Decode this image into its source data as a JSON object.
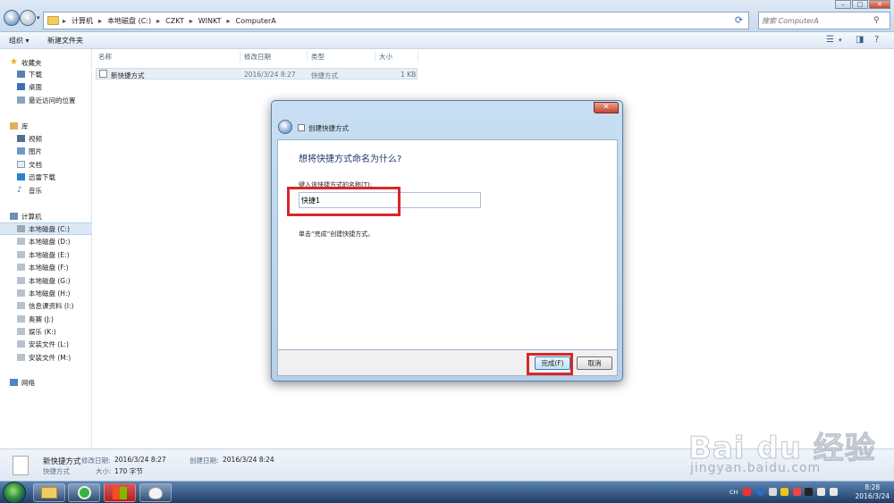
{
  "address_bar": {
    "breadcrumbs": [
      "计算机",
      "本地磁盘 (C:)",
      "CZKT",
      "WINKT",
      "ComputerA"
    ],
    "search_placeholder": "搜索 ComputerA"
  },
  "toolbar": {
    "organize_label": "组织 ▾",
    "new_folder_label": "新建文件夹"
  },
  "nav": {
    "favorites_header": "收藏夹",
    "favorites": [
      "下载",
      "桌面",
      "最近访问的位置"
    ],
    "libraries_header": "库",
    "libraries": [
      "视频",
      "图片",
      "文档",
      "迅雷下载",
      "音乐"
    ],
    "computer_header": "计算机",
    "drives": [
      "本地磁盘 (C:)",
      "本地磁盘 (D:)",
      "本地磁盘 (E:)",
      "本地磁盘 (F:)",
      "本地磁盘 (G:)",
      "本地磁盘 (H:)",
      "信息课资料 (I:)",
      "奥赛 (J:)",
      "娱乐 (K:)",
      "安装文件 (L:)",
      "安装文件 (M:)"
    ],
    "network_label": "网络"
  },
  "file_list": {
    "columns": [
      "名称",
      "修改日期",
      "类型",
      "大小"
    ],
    "rows": [
      {
        "name": "新快捷方式",
        "modified": "2016/3/24 8:27",
        "type": "快捷方式",
        "size": "1 KB"
      }
    ]
  },
  "dialog": {
    "title": "创建快捷方式",
    "heading": "想将快捷方式命名为什么?",
    "field_label": "键入该快捷方式的名称(T):",
    "field_value": "快捷1",
    "hint": "单击“完成”创建快捷方式。",
    "finish_label": "完成(F)",
    "cancel_label": "取消",
    "close_glyph": "✕"
  },
  "details": {
    "name": "新快捷方式",
    "type": "快捷方式",
    "modified_key": "修改日期:",
    "modified_value": "2016/3/24 8:27",
    "created_key": "创建日期:",
    "created_value": "2016/3/24 8:24",
    "size_key": "大小:",
    "size_value": "170 字节"
  },
  "watermark": {
    "brand": "Bai du 经验",
    "sub": "jingyan.baidu.com"
  },
  "taskbar": {
    "lang": "CH",
    "time": "8:28",
    "date": "2016/3/24"
  },
  "colors": {
    "highlight_red": "#d9262b",
    "accent_blue": "#1c3a6e"
  }
}
